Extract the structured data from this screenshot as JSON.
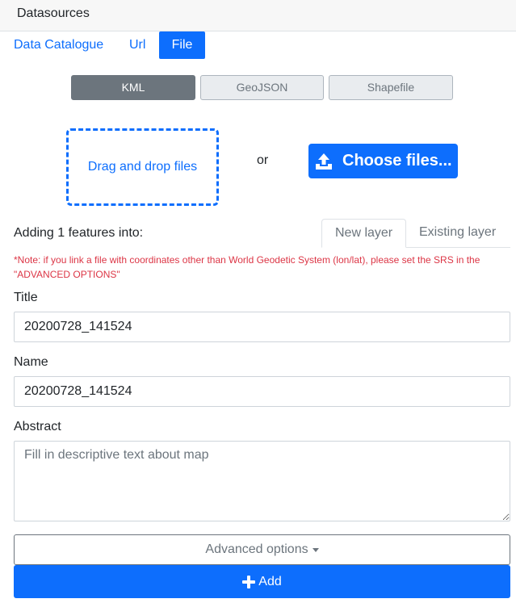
{
  "header": {
    "title": "Datasources"
  },
  "tabs": [
    {
      "label": "Data Catalogue"
    },
    {
      "label": "Url"
    },
    {
      "label": "File"
    }
  ],
  "active_tab": "File",
  "file_types": [
    {
      "label": "KML"
    },
    {
      "label": "GeoJSON"
    },
    {
      "label": "Shapefile"
    }
  ],
  "active_file_type": "KML",
  "upload": {
    "dropzone_label": "Drag and drop files",
    "or_label": "or",
    "choose_label": "Choose files..."
  },
  "adding": {
    "label": "Adding 1 features into:",
    "layer_tabs": [
      {
        "label": "New layer"
      },
      {
        "label": "Existing layer"
      }
    ],
    "active_layer_tab": "New layer"
  },
  "note": "*Note: if you link a file with coordinates other than World Geodetic System (lon/lat), please set the SRS in the \"ADVANCED OPTIONS\"",
  "form": {
    "title_label": "Title",
    "title_value": "20200728_141524",
    "name_label": "Name",
    "name_value": "20200728_141524",
    "abstract_label": "Abstract",
    "abstract_placeholder": "Fill in descriptive text about map"
  },
  "buttons": {
    "advanced_label": "Advanced options",
    "add_label": "Add"
  },
  "colors": {
    "primary": "#0d6efd",
    "secondary": "#6c757d",
    "danger": "#dc3545"
  },
  "icons": {
    "upload": "upload-icon",
    "caret": "caret-down-icon",
    "plus": "plus-icon"
  }
}
